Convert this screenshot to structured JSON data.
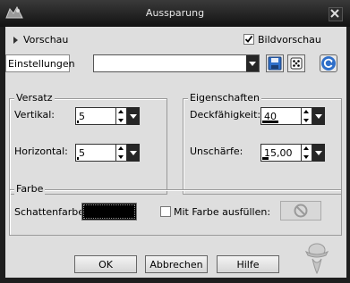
{
  "window": {
    "title": "Aussparung"
  },
  "preview": {
    "label": "Vorschau",
    "image_preview_label": "Bildvorschau",
    "image_preview_checked": true
  },
  "presets": {
    "label": "Einstellungen",
    "value": ""
  },
  "offset_group": {
    "title": "Versatz",
    "vertical": {
      "label": "Vertikal:",
      "value": "5",
      "fill": 0.05
    },
    "horizontal": {
      "label": "Horizontal:",
      "value": "5",
      "fill": 0.05
    }
  },
  "props_group": {
    "title": "Eigenschaften",
    "opacity": {
      "label": "Deckfähigkeit:",
      "value": "40",
      "fill": 0.4
    },
    "blur": {
      "label": "Unschärfe:",
      "value": "15,00",
      "fill": 0.15
    }
  },
  "color_group": {
    "title": "Farbe",
    "shadow_color_label": "Schattenfarbe:",
    "shadow_color": "#000000",
    "fill_label": "Mit Farbe ausfüllen:",
    "fill_checked": false
  },
  "buttons": {
    "ok": "OK",
    "cancel": "Abbrechen",
    "help": "Hilfe"
  },
  "colors": {
    "titlebar": "#1e1e1e",
    "dialog_bg": "#dedede",
    "accent_blue": "#2f6fc9"
  }
}
